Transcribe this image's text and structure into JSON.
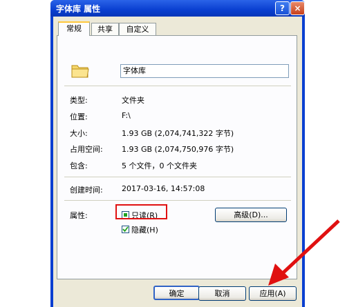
{
  "window": {
    "title": "字体库 属性",
    "help_button": "?",
    "close_button": "×"
  },
  "tabs": [
    {
      "label": "常规"
    },
    {
      "label": "共享"
    },
    {
      "label": "自定义"
    }
  ],
  "general": {
    "name_value": "字体库",
    "type": {
      "label": "类型:",
      "value": "文件夹"
    },
    "location": {
      "label": "位置:",
      "value": "F:\\"
    },
    "size": {
      "label": "大小:",
      "value": "1.93 GB (2,074,741,322 字节)"
    },
    "size_on_disk": {
      "label": "占用空间:",
      "value": "1.93 GB (2,074,750,976 字节)"
    },
    "contains": {
      "label": "包含:",
      "value": "5 个文件，0 个文件夹"
    },
    "created": {
      "label": "创建时间:",
      "value": "2017-03-16, 14:57:08"
    },
    "attributes": {
      "label": "属性:",
      "readonly": {
        "label": "只读(R)",
        "checked": "partial"
      },
      "hidden": {
        "label": "隐藏(H)",
        "checked": true
      },
      "advanced_button": "高级(D)..."
    }
  },
  "buttons": {
    "ok": "确定",
    "cancel": "取消",
    "apply": "应用(A)"
  },
  "colors": {
    "highlight_box": "#e01010",
    "arrow": "#e01010",
    "titlebar": "#0a3fd0"
  }
}
